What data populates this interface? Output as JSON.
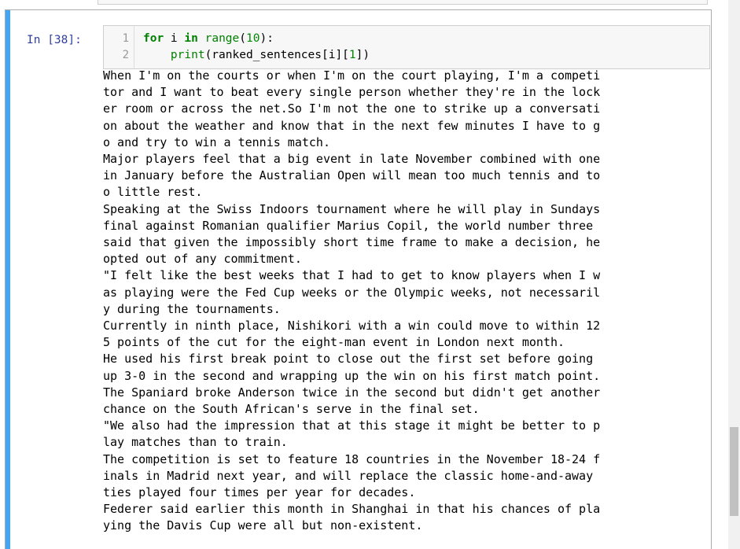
{
  "cell": {
    "prompt": "In [38]:",
    "code": {
      "line_numbers": [
        "1",
        "2"
      ],
      "line1": {
        "kw_for": "for",
        "var": " i ",
        "kw_in": "in",
        "space": " ",
        "fn": "range",
        "lp": "(",
        "num": "10",
        "rp": "):"
      },
      "line2": {
        "indent": "    ",
        "fn": "print",
        "args_open": "(ranked_sentences[i][",
        "num": "1",
        "args_close": "])"
      }
    },
    "output_lines": [
      "When I'm on the courts or when I'm on the court playing, I'm a competi",
      "tor and I want to beat every single person whether they're in the lock",
      "er room or across the net.So I'm not the one to strike up a conversati",
      "on about the weather and know that in the next few minutes I have to g",
      "o and try to win a tennis match.",
      "Major players feel that a big event in late November combined with one",
      "in January before the Australian Open will mean too much tennis and to",
      "o little rest.",
      "Speaking at the Swiss Indoors tournament where he will play in Sundays",
      "final against Romanian qualifier Marius Copil, the world number three",
      "said that given the impossibly short time frame to make a decision, he",
      "opted out of any commitment.",
      "\"I felt like the best weeks that I had to get to know players when I w",
      "as playing were the Fed Cup weeks or the Olympic weeks, not necessaril",
      "y during the tournaments.",
      "Currently in ninth place, Nishikori with a win could move to within 12",
      "5 points of the cut for the eight-man event in London next month.",
      "He used his first break point to close out the first set before going",
      "up 3-0 in the second and wrapping up the win on his first match point.",
      "The Spaniard broke Anderson twice in the second but didn't get another",
      "chance on the South African's serve in the final set.",
      "\"We also had the impression that at this stage it might be better to p",
      "lay matches than to train.",
      "The competition is set to feature 18 countries in the November 18-24 f",
      "inals in Madrid next year, and will replace the classic home-and-away",
      "ties played four times per year for decades.",
      "Federer said earlier this month in Shanghai in that his chances of pla",
      "ying the Davis Cup were all but non-existent."
    ]
  },
  "colors": {
    "selected_bar": "#42a5f5",
    "prompt": "#303f9f",
    "keyword": "#008000",
    "input_bg": "#f7f7f7"
  }
}
